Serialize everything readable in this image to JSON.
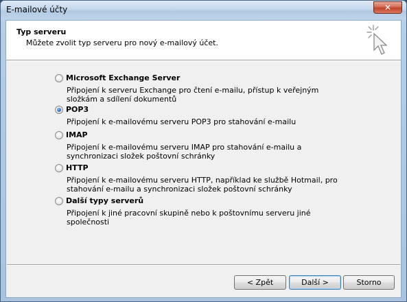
{
  "window": {
    "title": "E-mailové účty",
    "close_label": "✕"
  },
  "header": {
    "title": "Typ serveru",
    "subtitle": "Můžete zvolit typ serveru pro nový e-mailový účet.",
    "icon": "cursor-sparkle-icon"
  },
  "options": [
    {
      "label": "Microsoft Exchange Server",
      "description": "Připojení k serveru Exchange pro čtení e-mailu, přístup k veřejným složkám a sdílení dokumentů",
      "checked": false
    },
    {
      "label": "POP3",
      "description": "Připojení k e-mailovému serveru POP3 pro stahování e-mailu",
      "checked": true
    },
    {
      "label": "IMAP",
      "description": "Připojení k e-mailovému serveru IMAP pro stahování e-mailu a synchronizaci složek poštovní schránky",
      "checked": false
    },
    {
      "label": "HTTP",
      "description": "Připojení k e-mailovému serveru HTTP, například ke službě Hotmail, pro stahování e-mailu a synchronizaci složek poštovní schránky",
      "checked": false
    },
    {
      "label": "Další typy serverů",
      "description": "Připojení k jiné pracovní skupině nebo k poštovnímu serveru jiné společnosti",
      "checked": false
    }
  ],
  "buttons": {
    "back": "< Zpět",
    "next": "Další >",
    "cancel": "Storno"
  },
  "colors": {
    "accent": "#2a6fb8",
    "close_button": "#c0442a"
  }
}
